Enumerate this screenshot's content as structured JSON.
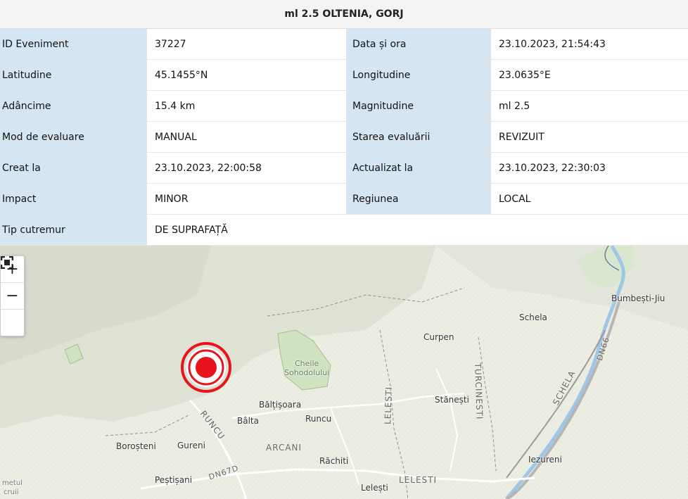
{
  "title": "ml 2.5 OLTENIA, GORJ",
  "rows": [
    {
      "l1": "ID Eveniment",
      "v1": "37227",
      "l2": "Data și ora",
      "v2": "23.10.2023, 21:54:43"
    },
    {
      "l1": "Latitudine",
      "v1": "45.1455°N",
      "l2": "Longitudine",
      "v2": "23.0635°E"
    },
    {
      "l1": "Adâncime",
      "v1": "15.4 km",
      "l2": "Magnitudine",
      "v2": "ml 2.5"
    },
    {
      "l1": "Mod de evaluare",
      "v1": "MANUAL",
      "l2": "Starea evaluării",
      "v2": "REVIZUIT"
    },
    {
      "l1": "Creat la",
      "v1": "23.10.2023, 22:00:58",
      "l2": "Actualizat la",
      "v2": "23.10.2023, 22:30:03"
    },
    {
      "l1": "Impact",
      "v1": "MINOR",
      "l2": "Regiunea",
      "v2": "LOCAL"
    }
  ],
  "last_row": {
    "l1": "Tip cutremur",
    "v1": "DE SUPRAFAȚĂ"
  },
  "map": {
    "zoom_in": "+",
    "zoom_out": "−",
    "fullscreen_icon": "fullscreen-icon",
    "places": {
      "bumbesti": "Bumbești-Jiu",
      "schela": "Schela",
      "curpen": "Curpen",
      "cheile1": "Cheile",
      "cheile2": "Sohodolului",
      "stanesti": "Stănești",
      "baltisoara": "Bălțișoara",
      "balta": "Bâlta",
      "runcu": "Runcu",
      "borosteni": "Boroșteni",
      "gureni": "Gureni",
      "rachiti": "Răchiti",
      "iezureni": "Iezureni",
      "pestisani": "Peștișani",
      "lelesti": "Lelești",
      "metul": "metul",
      "cruii": "cruii"
    },
    "roads": {
      "dn66": "DN66",
      "schela": "SCHELA",
      "turcinesti": "TURCINESTI",
      "lelesti_v": "LELESTI",
      "runcu_r": "RUNCU",
      "arcani": "ARCANI",
      "dn67d": "DN67D",
      "lelesti_h": "LELESTI"
    },
    "epicenter_color": "#e8141c"
  }
}
